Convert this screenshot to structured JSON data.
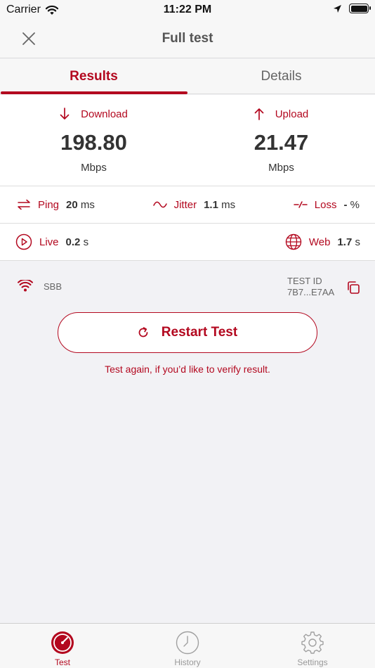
{
  "status_bar": {
    "carrier": "Carrier",
    "time": "11:22 PM"
  },
  "nav": {
    "title": "Full test"
  },
  "tabs": [
    {
      "label": "Results",
      "active": true
    },
    {
      "label": "Details",
      "active": false
    }
  ],
  "speeds": {
    "download": {
      "label": "Download",
      "value": "198.80",
      "unit": "Mbps"
    },
    "upload": {
      "label": "Upload",
      "value": "21.47",
      "unit": "Mbps"
    }
  },
  "metrics": {
    "ping": {
      "label": "Ping",
      "value": "20",
      "unit": "ms"
    },
    "jitter": {
      "label": "Jitter",
      "value": "1.1",
      "unit": "ms"
    },
    "loss": {
      "label": "Loss",
      "value": "-",
      "unit": "%"
    },
    "live": {
      "label": "Live",
      "value": "0.2",
      "unit": "s"
    },
    "web": {
      "label": "Web",
      "value": "1.7",
      "unit": "s"
    }
  },
  "network": {
    "ssid": "SBB",
    "test_id_label": "TEST ID",
    "test_id_value": "7B7...E7AA"
  },
  "restart": {
    "label": "Restart Test",
    "hint": "Test again, if you’d like to verify result."
  },
  "tabbar": [
    {
      "label": "Test",
      "icon": "speedometer-icon",
      "active": true
    },
    {
      "label": "History",
      "icon": "clock-icon",
      "active": false
    },
    {
      "label": "Settings",
      "icon": "gear-icon",
      "active": false
    }
  ],
  "colors": {
    "accent": "#b3081f",
    "background": "#f2f2f5",
    "bar": "#f7f7f7"
  }
}
